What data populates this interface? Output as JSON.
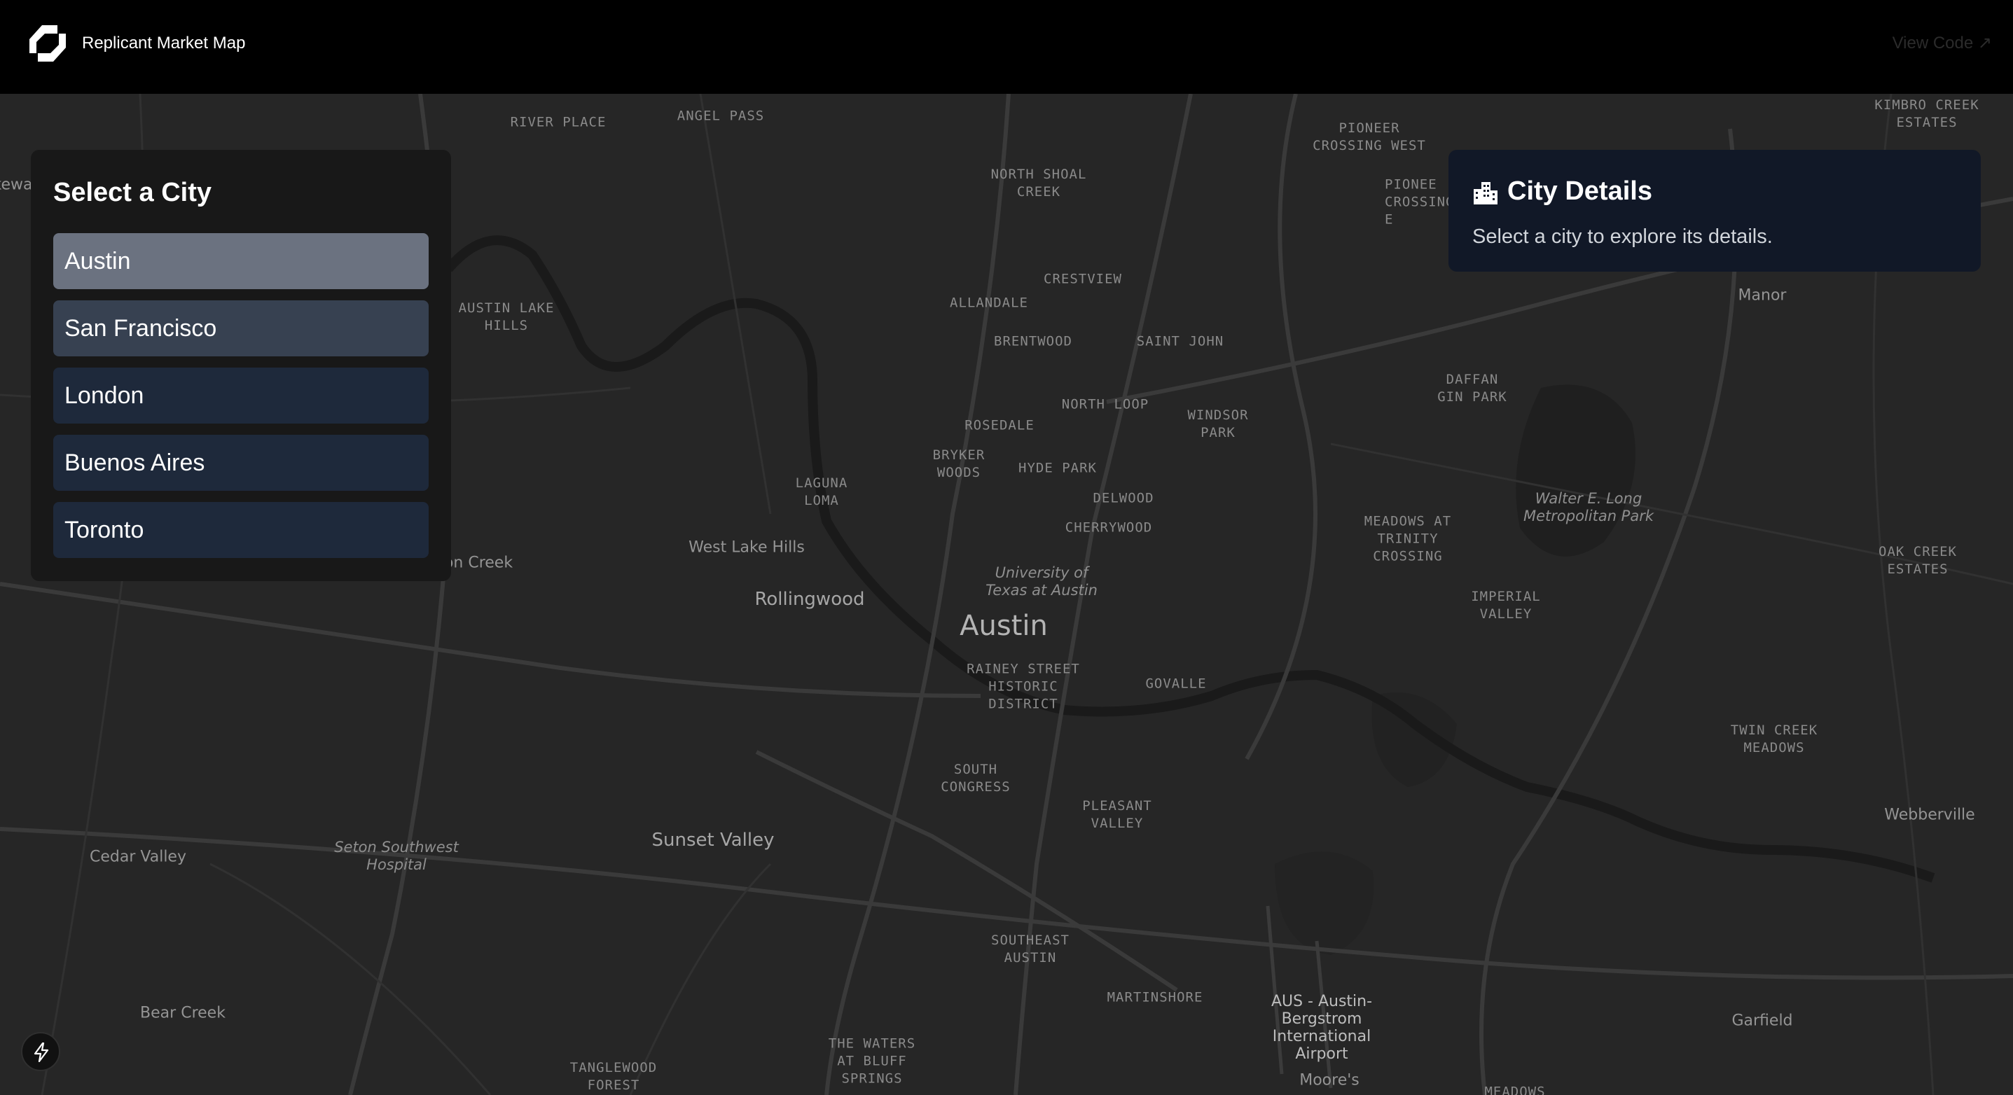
{
  "header": {
    "logo_icon": "replicant-logo-icon",
    "title": "Replicant Market Map",
    "view_code_label": "View Code ↗"
  },
  "city_selector": {
    "title": "Select a City",
    "cities": [
      "Austin",
      "San Francisco",
      "London",
      "Buenos Aires",
      "Toronto"
    ],
    "selected": "Austin"
  },
  "city_details": {
    "icon": "buildings-icon",
    "title": "City Details",
    "description": "Select a city to explore its details."
  },
  "map": {
    "city": "Austin",
    "labels": {
      "river_place": "RIVER PLACE",
      "angel_pass": "ANGEL PASS",
      "pioneer_crossing_west": "PIONEER CROSSING WEST",
      "pioneer_crossing_east": "PIONEE CROSSING E",
      "kimbro_creek_estates": "KIMBRO CREEK ESTATES",
      "north_shoal_creek": "NORTH SHOAL CREEK",
      "crestview": "CRESTVIEW",
      "allandale": "ALLANDALE",
      "brentwood": "BRENTWOOD",
      "saint_john": "SAINT JOHN",
      "austin_lake_hills": "AUSTIN LAKE HILLS",
      "manor": "Manor",
      "daffan_gin_park": "DAFFAN GIN PARK",
      "rosedale": "ROSEDALE",
      "north_loop": "NORTH LOOP",
      "windsor_park": "WINDSOR PARK",
      "bryker_woods": "BRYKER WOODS",
      "hyde_park": "HYDE PARK",
      "laguna_loma": "LAGUNA LOMA",
      "delwood": "DELWOOD",
      "walter_e_long": "Walter E. Long Metropolitan Park",
      "meadows_trinity": "MEADOWS AT TRINITY CROSSING",
      "cherrywood": "CHERRYWOOD",
      "oak_creek_estates": "OAK CREEK ESTATES",
      "west_lake_hills": "West Lake Hills",
      "on_creek": "on Creek",
      "ut_austin": "University of Texas at Austin",
      "imperial_valley": "IMPERIAL VALLEY",
      "rollingwood": "Rollingwood",
      "austin": "Austin",
      "rainey_street": "RAINEY STREET HISTORIC DISTRICT",
      "govalle": "GOVALLE",
      "twin_creek_meadows": "TWIN CREEK MEADOWS",
      "south_congress": "SOUTH CONGRESS",
      "pleasant_valley": "PLEASANT VALLEY",
      "webberville": "Webberville",
      "sunset_valley": "Sunset Valley",
      "seton_southwest": "Seton Southwest Hospital",
      "cedar_valley": "Cedar Valley",
      "southeast_austin": "SOUTHEAST AUSTIN",
      "martinshore": "MARTINSHORE",
      "aus_airport": "AUS - Austin-Bergstrom International Airport",
      "bear_creek": "Bear Creek",
      "garfield": "Garfield",
      "waters_at_bluff_springs": "THE WATERS AT BLUFF SPRINGS",
      "tanglewood_forest": "TANGLEWOOD FOREST",
      "moores": "Moore's",
      "meadows_bottom": "MEADOWS",
      "lakeway_partial": "kewa"
    }
  }
}
